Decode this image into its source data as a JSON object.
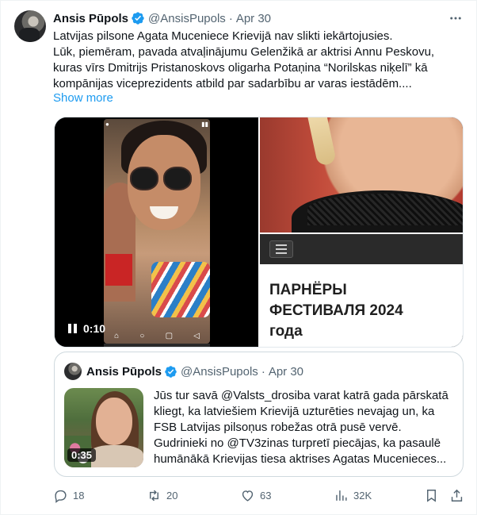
{
  "tweet": {
    "author_name": "Ansis Pūpols",
    "handle": "@AnsisPupols",
    "separator": "·",
    "date": "Apr 30",
    "more_icon": "more-horizontal-icon",
    "text_lines": [
      "Latvijas pilsone Agata Muceniece Krievijā nav slikti iekārtojusies.",
      "Lūk, piemēram, pavada atvaļinājumu Gelenžikā ar aktrisi Annu Peskovu,",
      "kuras vīrs Dmitrijs Pristanoskovs oligarha Potaņina “Norilskas niķelī” kā",
      "kompānijas viceprezidents atbild par sadarbību ar varas iestādēm...."
    ],
    "show_more": "Show more",
    "media": {
      "video_time": "0:10",
      "festival_title_lines": [
        "ПАРНЁРЫ",
        "ФЕСТИВАЛЯ 2024",
        "года"
      ]
    },
    "quote": {
      "author_name": "Ansis Pūpols",
      "handle": "@AnsisPupols",
      "separator": "·",
      "date": "Apr 30",
      "video_time": "0:35",
      "text_lines": [
        "Jūs tur savā @Valsts_drosiba varat katrā gada pārskatā",
        "kliegt, ka latviešiem Krievijā uzturēties nevajag un, ka",
        "FSB Latvijas pilsoņus robežas otrā pusē vervē.",
        "Gudrinieki no @TV3zinas turpretī piecājas, ka pasaulē",
        "humānākā Krievijas tiesa aktrises Agatas Mucenieces..."
      ]
    },
    "actions": {
      "replies": "18",
      "reposts": "20",
      "likes": "63",
      "views": "32K"
    },
    "colors": {
      "accent": "#1d9bf0",
      "text": "#0f1419",
      "secondary": "#536471",
      "repost_green": "#00ba7c"
    }
  }
}
